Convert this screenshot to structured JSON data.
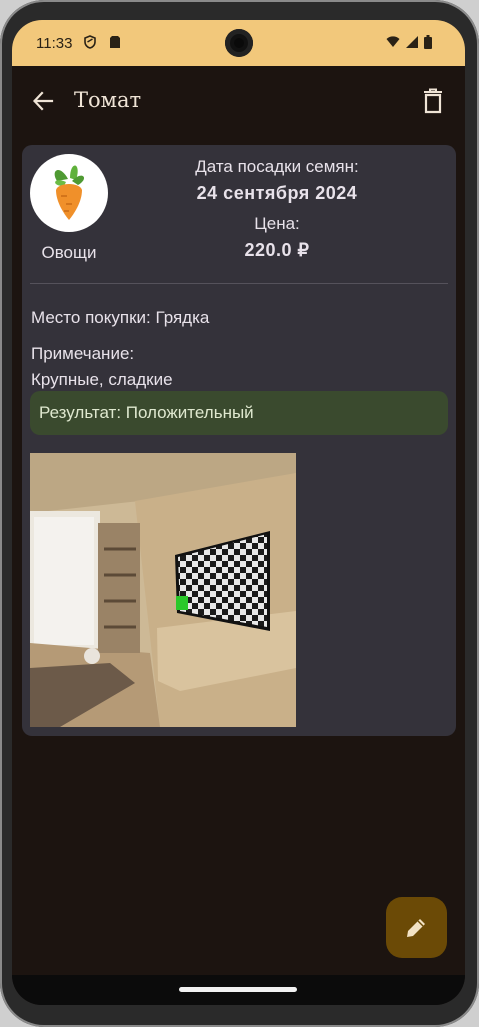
{
  "status_bar": {
    "time": "11:33"
  },
  "app_bar": {
    "title": "Томат"
  },
  "card": {
    "category": "Овощи",
    "planting_date_label": "Дата посадки семян:",
    "planting_date_value": "24 сентября 2024",
    "price_label": "Цена:",
    "price_value": "220.0 ₽",
    "purchase_place": "Место покупки: Грядка",
    "note_label": "Примечание:",
    "note_value": "Крупные, сладкие",
    "result": "Результат: Положительный"
  },
  "icons": {
    "back": "arrow-back-icon",
    "delete": "trash-icon",
    "edit": "pencil-icon",
    "avatar": "carrot-icon"
  },
  "colors": {
    "status_bar": "#f2c87b",
    "background": "#1c1410",
    "card": "#34323a",
    "result_bg": "#3a4a2e",
    "fab": "#6b4a06"
  }
}
